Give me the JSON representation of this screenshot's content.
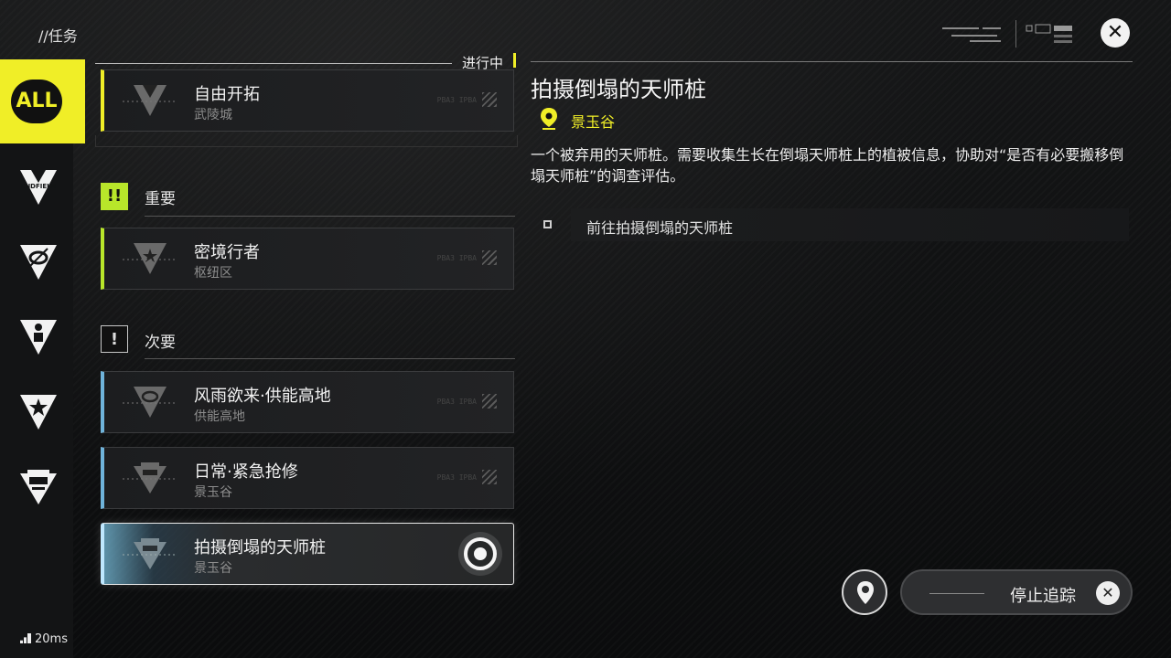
{
  "header": {
    "title": "//任务"
  },
  "sidebar": {
    "items": [
      {
        "label": "ALL",
        "icon": "all-icon",
        "active": true
      },
      {
        "label": "ENDFIELD",
        "icon": "endfield-icon"
      },
      {
        "label": "",
        "icon": "ring-emblem-icon"
      },
      {
        "label": "",
        "icon": "person-emblem-icon"
      },
      {
        "label": "",
        "icon": "star-emblem-icon"
      },
      {
        "label": "",
        "icon": "building-emblem-icon"
      }
    ]
  },
  "list": {
    "ongoing_label": "进行中",
    "ongoing_card": {
      "title": "自由开拓",
      "subtitle": "武陵城",
      "code": "PBA3 IPBA"
    },
    "sections": [
      {
        "badge": "!!",
        "label": "重要",
        "cards": [
          {
            "title": "密境行者",
            "subtitle": "枢纽区",
            "code": "PBA3 IPBA"
          }
        ]
      },
      {
        "badge": "!",
        "label": "次要",
        "cards": [
          {
            "title": "风雨欲来·供能高地",
            "subtitle": "供能高地",
            "code": "PBA3 IPBA"
          },
          {
            "title": "日常·紧急抢修",
            "subtitle": "景玉谷",
            "code": "PBA3 IPBA"
          },
          {
            "title": "拍摄倒塌的天师桩",
            "subtitle": "景玉谷",
            "code": "",
            "selected": true
          }
        ]
      }
    ]
  },
  "detail": {
    "title": "拍摄倒塌的天师桩",
    "location": "景玉谷",
    "description": "一个被弃用的天师桩。需要收集生长在倒塌天师桩上的植被信息，协助对“是否有必要搬移倒塌天师桩”的调查评估。",
    "objectives": [
      {
        "text": "前往拍摄倒塌的天师桩",
        "done": false
      }
    ]
  },
  "actions": {
    "stop_tracking": "停止追踪"
  },
  "status": {
    "ping": "20ms"
  },
  "colors": {
    "accent_yellow": "#f0ee27",
    "important_green": "#b8e62a",
    "minor_blue": "#6fb3da"
  }
}
